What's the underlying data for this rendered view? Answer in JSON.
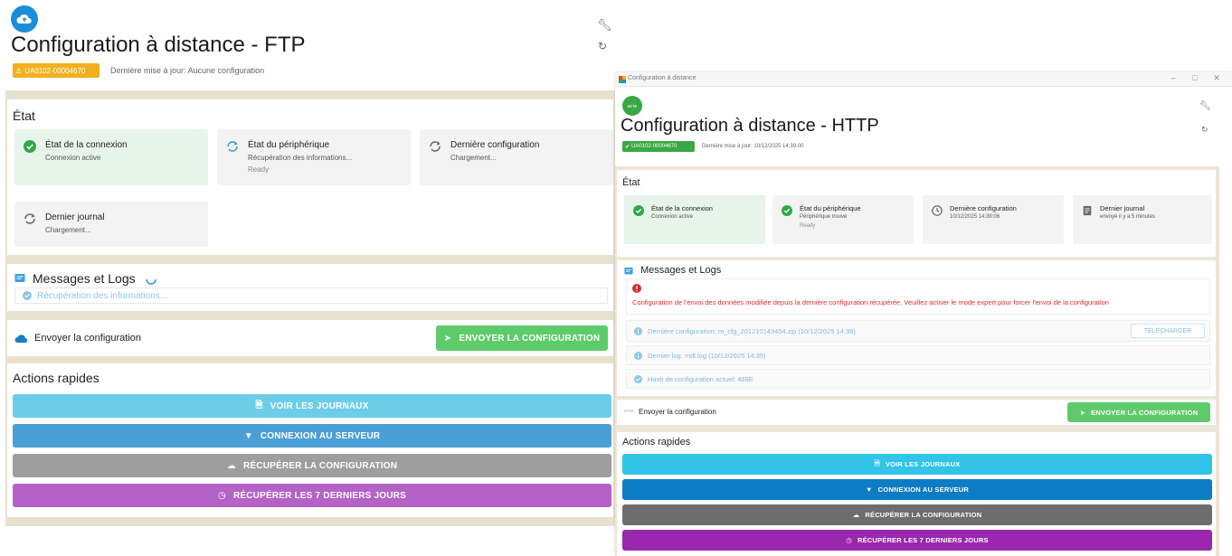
{
  "ftp": {
    "title": "Configuration à distance - FTP",
    "badge": "UA0102-00004670",
    "last_update": "Dernière mise à jour: Aucune configuration",
    "state_title": "État",
    "tiles": [
      {
        "title": "État de la connexion",
        "sub": "Connexion active",
        "extra": ""
      },
      {
        "title": "État du périphérique",
        "sub": "Récupération des informations...",
        "extra": "Ready"
      },
      {
        "title": "Dernière configuration",
        "sub": "Chargement...",
        "extra": ""
      },
      {
        "title": "Dernier journal",
        "sub": "Chargement...",
        "extra": ""
      }
    ],
    "messages_title": "Messages et Logs",
    "messages_loading": "Récupération des informations...",
    "send_label": "Envoyer la configuration",
    "send_button": "ENVOYER LA CONFIGURATION",
    "quick_title": "Actions rapides",
    "actions": [
      {
        "label": "VOIR LES JOURNAUX",
        "color": "#6dcde8"
      },
      {
        "label": "CONNEXION AU SERVEUR",
        "color": "#4a9fd6"
      },
      {
        "label": "RÉCUPÉRER LA CONFIGURATION",
        "color": "#9e9e9e"
      },
      {
        "label": "RÉCUPÉRER LES 7 DERNIERS JOURS",
        "color": "#b562c8"
      }
    ]
  },
  "http": {
    "window_title": "Configuration à distance",
    "badge_circle": "HTTP",
    "title": "Configuration à distance - HTTP",
    "badge": "UA0102-00004670",
    "last_update": "Dernière mise à jour: 10/12/2025 14:39:00",
    "state_title": "État",
    "tiles": [
      {
        "title": "État de la connexion",
        "sub": "Connexion active",
        "extra": ""
      },
      {
        "title": "État du périphérique",
        "sub": "Périphérique trouvé",
        "extra": "Ready"
      },
      {
        "title": "Dernière configuration",
        "sub": "10/12/2025 14:39:06",
        "extra": ""
      },
      {
        "title": "Dernier journal",
        "sub": "envoyé il y a 5 minutes",
        "extra": ""
      }
    ],
    "messages_title": "Messages et Logs",
    "error_text": "Configuration de l'envoi des données modifiée depuis la dernière configuration récupérée. Veuillez activer le mode expert pour forcer l'envoi de la configuration",
    "logs": [
      "Dernière configuration: m_cfg_20121014345​4.zip (10/12/2025 14:39)",
      "Dernier log: mdl.log (10/12/2025 14:39)",
      "Hash de configuration actuel: 486E"
    ],
    "download_button": "TÉLÉCHARGER",
    "send_prefix": "HTTP",
    "send_label": "Envoyer la configuration",
    "send_button": "ENVOYER LA CONFIGURATION",
    "quick_title": "Actions rapides",
    "actions": [
      {
        "label": "VOIR LES JOURNAUX",
        "color": "#31c3e8"
      },
      {
        "label": "CONNEXION AU SERVEUR",
        "color": "#0d7cc4"
      },
      {
        "label": "RÉCUPÉRER LA CONFIGURATION",
        "color": "#6d6d6d"
      },
      {
        "label": "RÉCUPÉRER LES 7 DERNIERS JOURS",
        "color": "#9a27ae"
      }
    ]
  }
}
